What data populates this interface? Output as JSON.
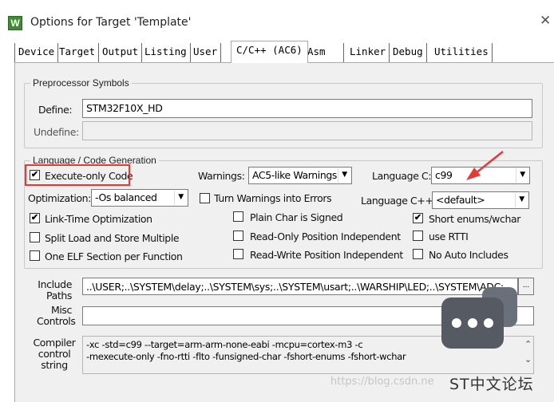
{
  "window": {
    "title": "Options for Target 'Template'",
    "icon_label": "W",
    "close_glyph": "✕"
  },
  "tabs": [
    {
      "label": "Device"
    },
    {
      "label": "Target"
    },
    {
      "label": "Output"
    },
    {
      "label": "Listing"
    },
    {
      "label": "User"
    },
    {
      "label": "C/C++ (AC6)",
      "active": true
    },
    {
      "label": "Asm"
    },
    {
      "label": "Linker"
    },
    {
      "label": "Debug"
    },
    {
      "label": "Utilities"
    }
  ],
  "preprocessor": {
    "group_title": "Preprocessor Symbols",
    "define_label": "Define:",
    "define_value": "STM32F10X_HD",
    "undefine_label": "Undefine:",
    "undefine_value": ""
  },
  "language": {
    "group_title": "Language / Code Generation",
    "execute_only": {
      "label": "Execute-only Code",
      "checked": true
    },
    "warnings_label": "Warnings:",
    "warnings_value": "AC5-like Warnings",
    "language_c_label": "Language C:",
    "language_c_value": "c99",
    "optimization_label": "Optimization:",
    "optimization_value": "-Os balanced",
    "turn_warnings_errors": {
      "label": "Turn Warnings into Errors",
      "checked": false
    },
    "language_cpp_label": "Language C++:",
    "language_cpp_value": "<default>",
    "link_time_opt": {
      "label": "Link-Time Optimization",
      "checked": true
    },
    "plain_char_signed": {
      "label": "Plain Char is Signed",
      "checked": false
    },
    "short_enums": {
      "label": "Short enums/wchar",
      "checked": true
    },
    "split_load_store": {
      "label": "Split Load and Store Multiple",
      "checked": false
    },
    "ro_position_indep": {
      "label": "Read-Only Position Independent",
      "checked": false
    },
    "use_rtti": {
      "label": "use RTTI",
      "checked": false
    },
    "one_elf_section": {
      "label": "One ELF Section per Function",
      "checked": false
    },
    "rw_position_indep": {
      "label": "Read-Write Position Independent",
      "checked": false
    },
    "no_auto_includes": {
      "label": "No Auto Includes",
      "checked": false
    }
  },
  "include_paths": {
    "label_line1": "Include",
    "label_line2": "Paths",
    "value": "..\\USER;..\\SYSTEM\\delay;..\\SYSTEM\\sys;..\\SYSTEM\\usart;..\\WARSHIP\\LED;..\\SYSTEM\\ADC;..",
    "browse_label": "..."
  },
  "misc_controls": {
    "label_line1": "Misc",
    "label_line2": "Controls",
    "value": ""
  },
  "compiler_control": {
    "label_line1": "Compiler",
    "label_line2": "control",
    "label_line3": "string",
    "line1": "-xc -std=c99 --target=arm-arm-none-eabi -mcpu=cortex-m3 -c",
    "line2": "-mexecute-only -fno-rtti -flto -funsigned-char -fshort-enums -fshort-wchar"
  },
  "checkmark": "✔",
  "dropdown_arrow": "▼",
  "scroll_up": "⌃",
  "scroll_down": "⌄",
  "watermark": {
    "url": "https://blog.csdn.ne",
    "brand": "ST中文论坛"
  },
  "colors": {
    "highlight_box": "#e53935",
    "arrow": "#e53935",
    "panel_bg": "#f0f0f0"
  }
}
